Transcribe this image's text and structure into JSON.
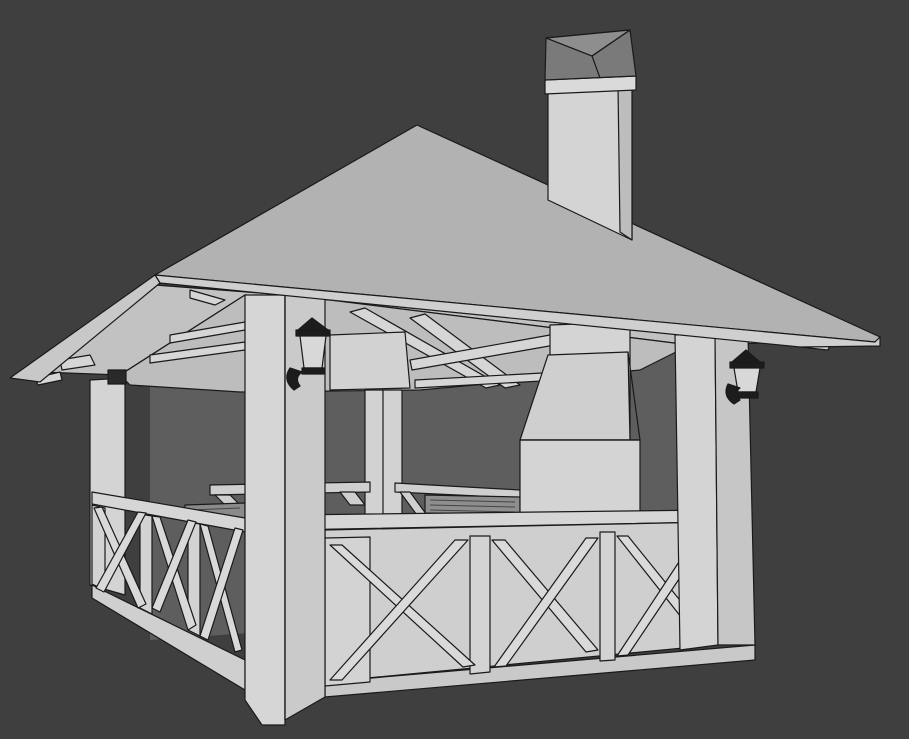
{
  "viewport": {
    "background": "#3f3f3f",
    "render_style": "solid shading with wireframe outlines"
  },
  "model": {
    "subject": "gazebo",
    "features": [
      "hip-roof",
      "chimney",
      "barbecue-hearth",
      "x-brace-railing",
      "wall-lanterns",
      "table-with-benches",
      "grill-rack"
    ]
  },
  "colors": {
    "roof_top": "#b2b2b2",
    "roof_side": "#cfcfcf",
    "roof_underside": "#c2c2c2",
    "wood": "#d4d4d4",
    "wood_shade": "#b9b9b9",
    "interior_shadow": "#5e5e5e",
    "outline": "#1a1a1a",
    "lantern": "#1c1c1c"
  }
}
